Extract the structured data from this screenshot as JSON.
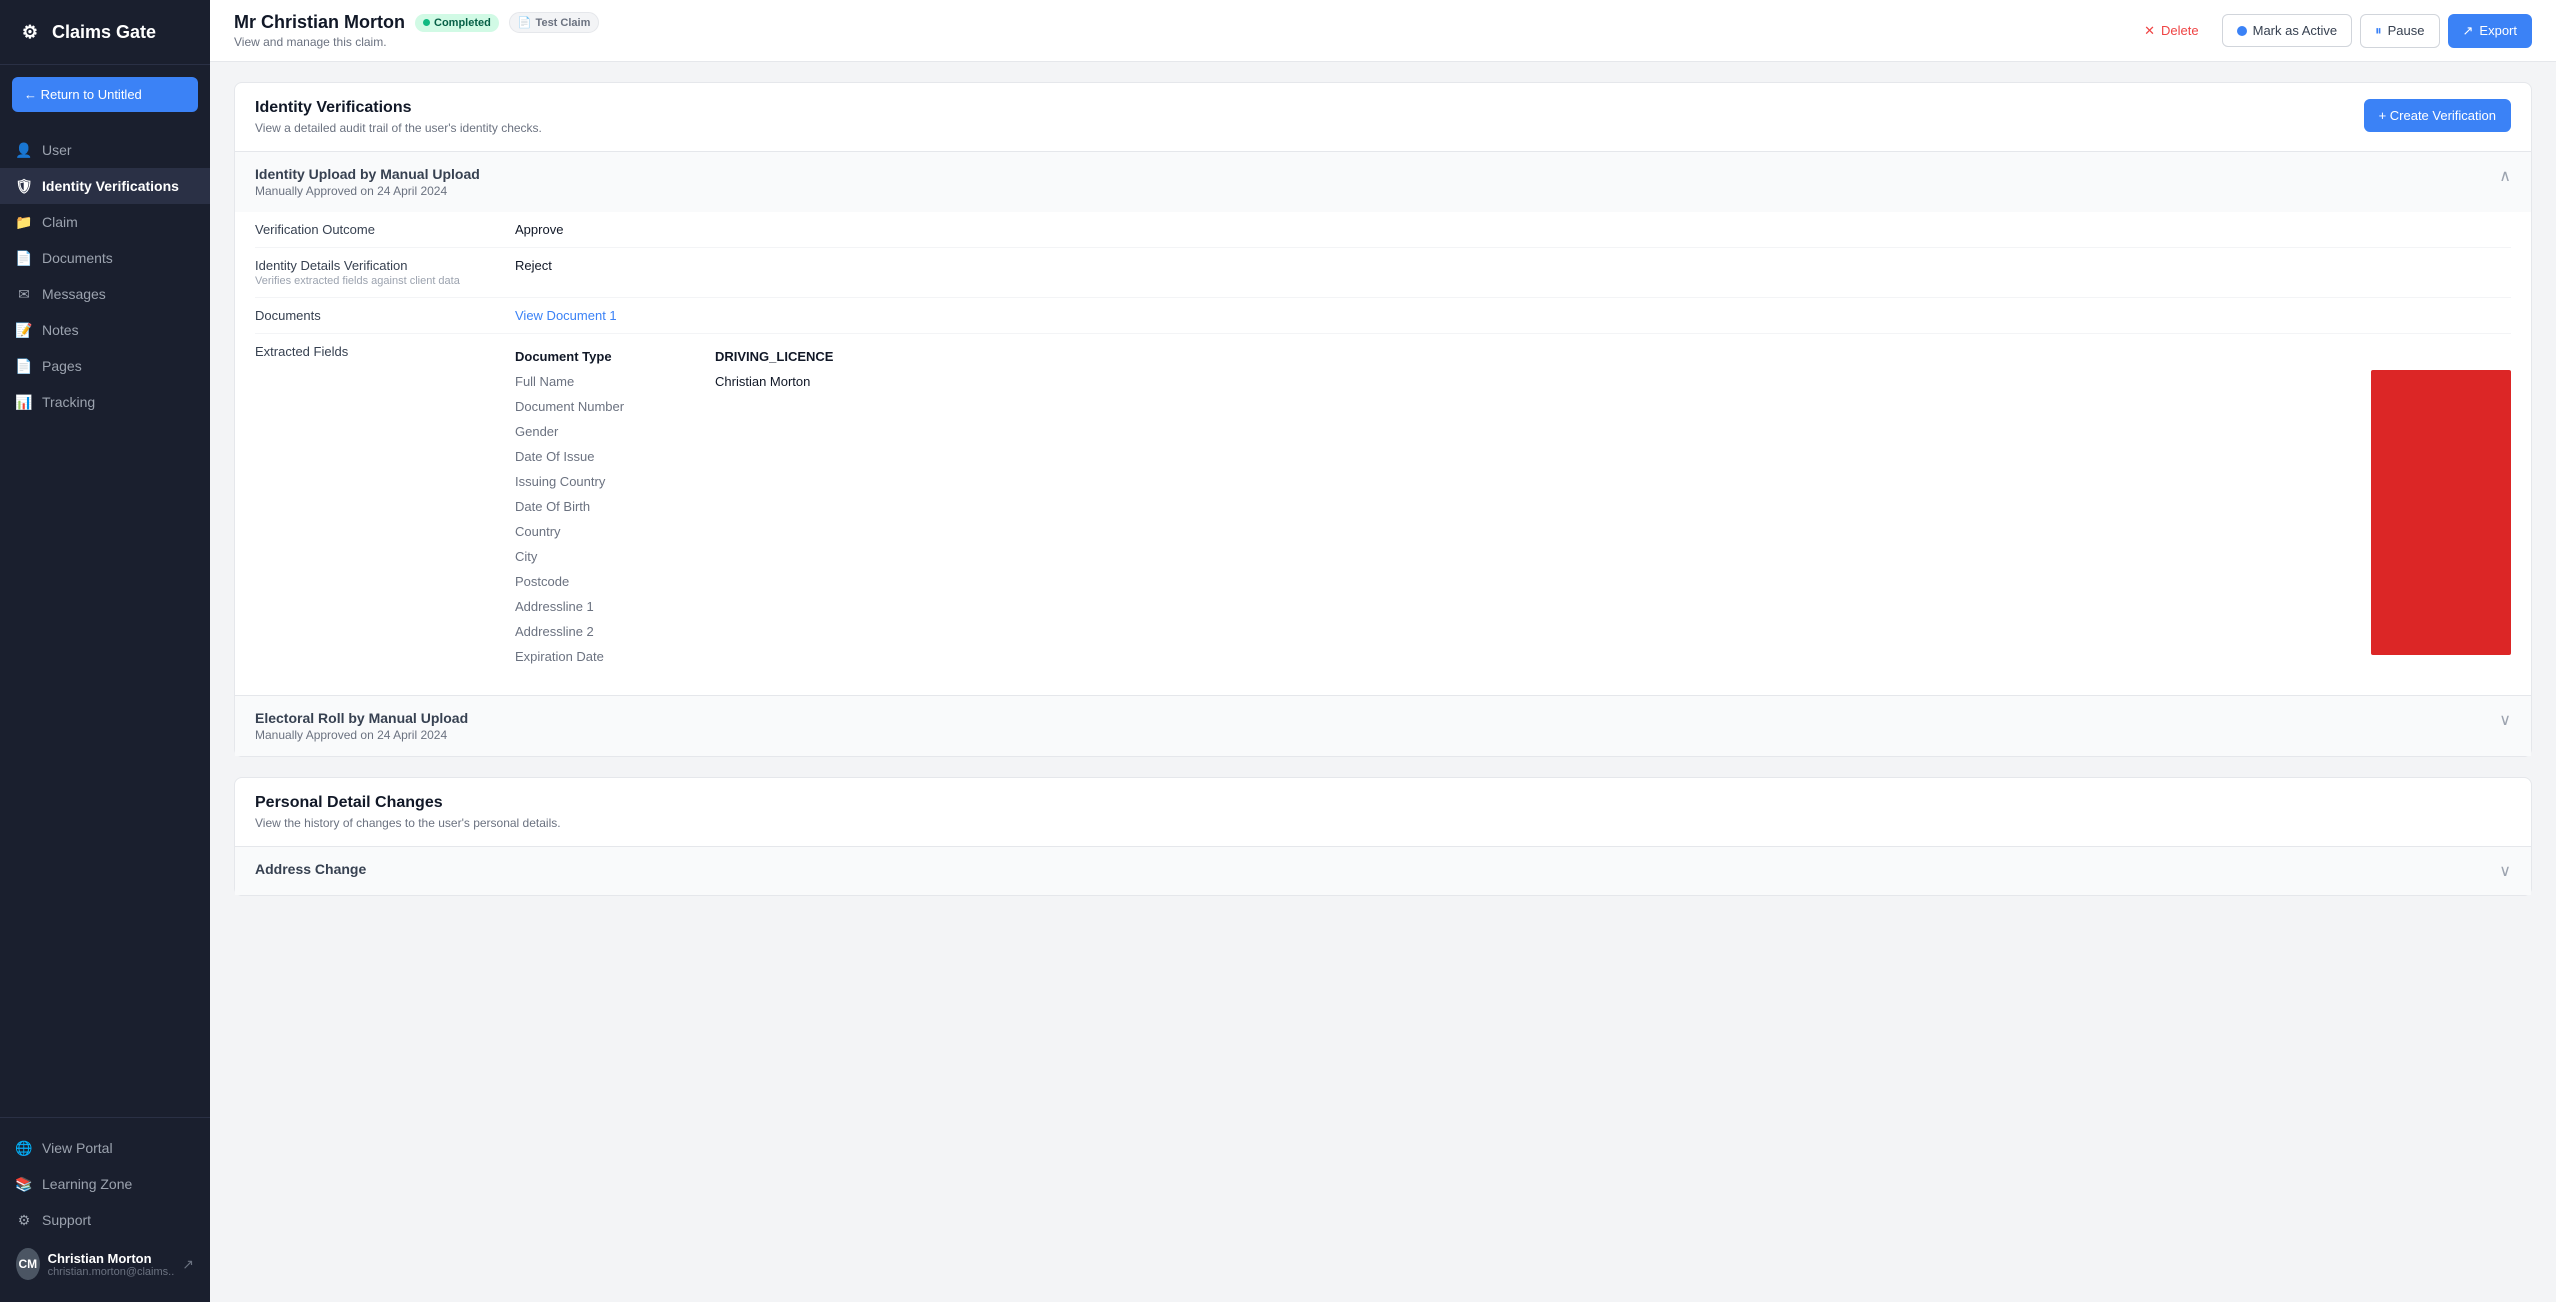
{
  "app": {
    "logo_text": "Claims Gate",
    "logo_icon": "⚙"
  },
  "sidebar": {
    "return_btn": "← Return to Untitled",
    "nav_items": [
      {
        "id": "user",
        "label": "User",
        "icon": "👤",
        "active": false
      },
      {
        "id": "identity-verifications",
        "label": "Identity Verifications",
        "icon": "🛡",
        "active": true
      },
      {
        "id": "claim",
        "label": "Claim",
        "icon": "📁",
        "active": false
      },
      {
        "id": "documents",
        "label": "Documents",
        "icon": "📄",
        "active": false
      },
      {
        "id": "messages",
        "label": "Messages",
        "icon": "✉",
        "active": false
      },
      {
        "id": "notes",
        "label": "Notes",
        "icon": "📝",
        "active": false
      },
      {
        "id": "pages",
        "label": "Pages",
        "icon": "📄",
        "active": false
      },
      {
        "id": "tracking",
        "label": "Tracking",
        "icon": "📊",
        "active": false
      }
    ],
    "bottom_items": [
      {
        "id": "view-portal",
        "label": "View Portal",
        "icon": "🌐"
      },
      {
        "id": "learning-zone",
        "label": "Learning Zone",
        "icon": "📚"
      },
      {
        "id": "support",
        "label": "Support",
        "icon": "⚙"
      }
    ],
    "user": {
      "name": "Christian Morton",
      "email": "christian.morton@claims.."
    }
  },
  "header": {
    "client_name": "Mr Christian Morton",
    "status_completed": "Completed",
    "status_test": "Test Claim",
    "subtitle": "View and manage this claim.",
    "actions": {
      "delete": "Delete",
      "mark_active": "Mark as Active",
      "pause": "Pause",
      "export": "Export"
    }
  },
  "identity_verifications": {
    "section_title": "Identity Verifications",
    "section_subtitle": "View a detailed audit trail of the user's identity checks.",
    "create_btn": "+ Create Verification",
    "upload_section": {
      "title": "Identity Upload by Manual Upload",
      "subtitle": "Manually Approved on 24 April 2024",
      "fields": [
        {
          "label": "Verification Outcome",
          "label_sub": "",
          "value": "Approve",
          "type": "text"
        },
        {
          "label": "Identity Details Verification",
          "label_sub": "Verifies extracted fields against client data",
          "value": "Reject",
          "type": "text"
        },
        {
          "label": "Documents",
          "label_sub": "",
          "value": "View Document 1",
          "type": "link"
        },
        {
          "label": "Extracted Fields",
          "label_sub": "",
          "value": "",
          "type": "extracted"
        }
      ],
      "extracted_fields": {
        "col_header": "Document Type",
        "col_value": "DRIVING_LICENCE",
        "rows": [
          {
            "label": "Full Name",
            "value": "Christian Morton",
            "redacted": false
          },
          {
            "label": "Document Number",
            "value": "",
            "redacted": true
          },
          {
            "label": "Gender",
            "value": "",
            "redacted": true
          },
          {
            "label": "Date Of Issue",
            "value": "",
            "redacted": true
          },
          {
            "label": "Issuing Country",
            "value": "",
            "redacted": true
          },
          {
            "label": "Date Of Birth",
            "value": "",
            "redacted": true
          },
          {
            "label": "Country",
            "value": "",
            "redacted": true
          },
          {
            "label": "City",
            "value": "",
            "redacted": true
          },
          {
            "label": "Postcode",
            "value": "",
            "redacted": true
          },
          {
            "label": "Addressline 1",
            "value": "",
            "redacted": true
          },
          {
            "label": "Addressline 2",
            "value": "",
            "redacted": true
          },
          {
            "label": "Expiration Date",
            "value": "",
            "redacted": true
          }
        ]
      }
    },
    "electoral_section": {
      "title": "Electoral Roll by Manual Upload",
      "subtitle": "Manually Approved on 24 April 2024"
    }
  },
  "personal_detail_changes": {
    "section_title": "Personal Detail Changes",
    "section_subtitle": "View the history of changes to the user's personal details.",
    "address_change_label": "Address Change"
  }
}
